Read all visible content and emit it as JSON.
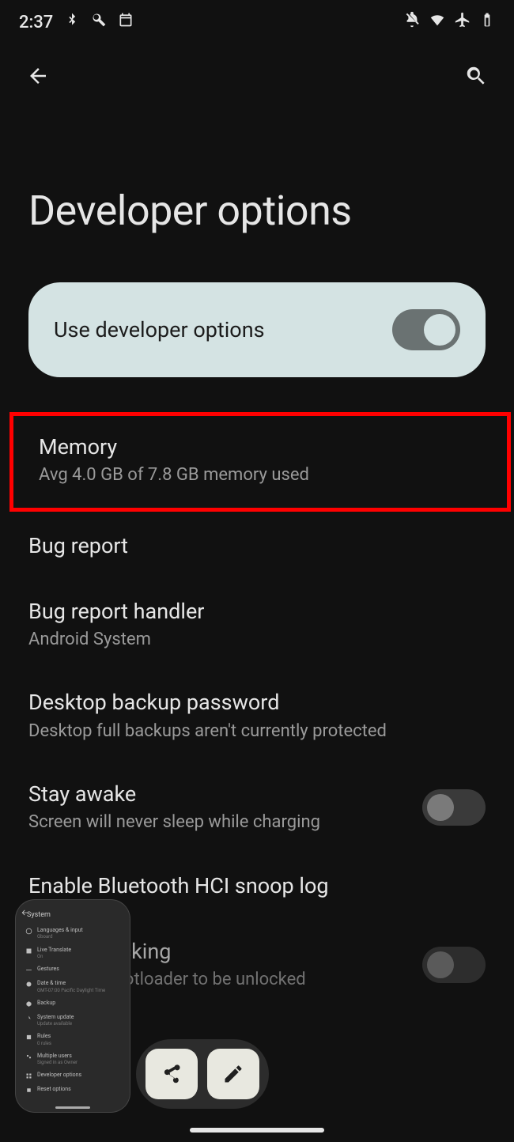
{
  "status": {
    "time": "2:37",
    "icons_left": [
      "bluetooth-icon",
      "wrench-icon",
      "calendar-icon"
    ],
    "icons_right": [
      "notifications-off-icon",
      "wifi-icon",
      "airplane-icon",
      "battery-icon"
    ]
  },
  "page": {
    "title": "Developer options"
  },
  "master_toggle": {
    "label": "Use developer options",
    "on": true
  },
  "settings": [
    {
      "title": "Memory",
      "subtitle": "Avg 4.0 GB of 7.8 GB memory used",
      "highlighted": true
    },
    {
      "title": "Bug report"
    },
    {
      "title": "Bug report handler",
      "subtitle": "Android System"
    },
    {
      "title": "Desktop backup password",
      "subtitle": "Desktop full backups aren't currently protected"
    },
    {
      "title": "Stay awake",
      "subtitle": "Screen will never sleep while charging",
      "switch": true,
      "switch_on": false
    },
    {
      "title": "Enable Bluetooth HCI snoop log"
    },
    {
      "title": "OEM unlocking",
      "subtitle": "Allow the bootloader to be unlocked",
      "switch": true,
      "switch_on": false
    }
  ],
  "screenshot_preview": {
    "title": "System",
    "items": [
      {
        "label": "Languages & input",
        "sub": "Gboard"
      },
      {
        "label": "Live Translate",
        "sub": "On"
      },
      {
        "label": "Gestures"
      },
      {
        "label": "Date & time",
        "sub": "GMT-07:00 Pacific Daylight Time"
      },
      {
        "label": "Backup"
      },
      {
        "label": "System update",
        "sub": "Update available"
      },
      {
        "label": "Rules",
        "sub": "0 rules"
      },
      {
        "label": "Multiple users",
        "sub": "Signed in as Owner"
      },
      {
        "label": "Developer options"
      },
      {
        "label": "Reset options"
      }
    ]
  }
}
